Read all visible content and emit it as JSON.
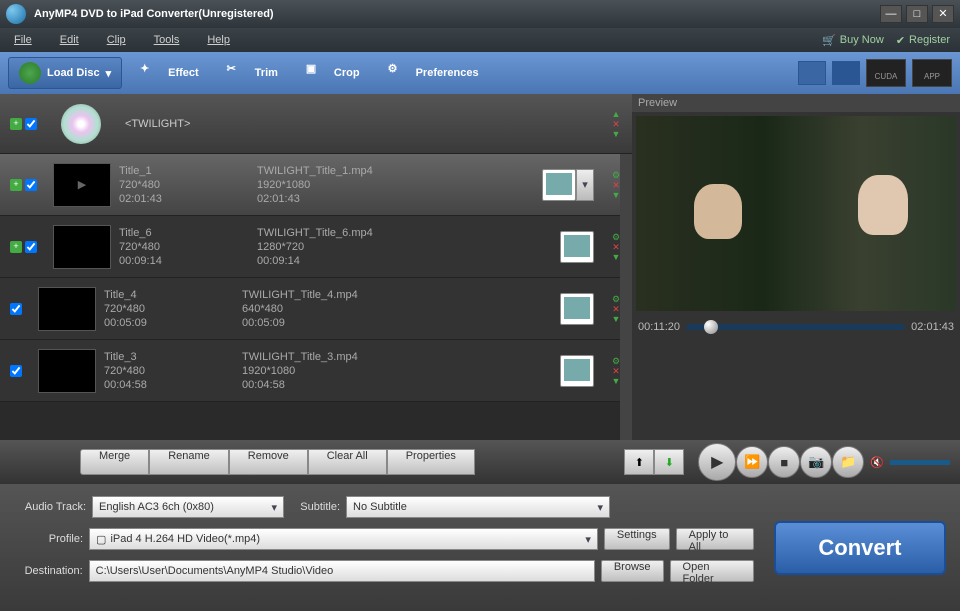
{
  "title": "AnyMP4 DVD to iPad Converter(Unregistered)",
  "menu": {
    "file": "File",
    "edit": "Edit",
    "clip": "Clip",
    "tools": "Tools",
    "help": "Help"
  },
  "header_links": {
    "buy": "Buy Now",
    "register": "Register"
  },
  "toolbar": {
    "load": "Load Disc",
    "effect": "Effect",
    "trim": "Trim",
    "crop": "Crop",
    "prefs": "Preferences"
  },
  "accel": {
    "cuda": "CUDA",
    "app": "APP"
  },
  "disc": {
    "name": "<TWILIGHT>"
  },
  "titles": [
    {
      "name": "Title_1",
      "res": "720*480",
      "dur": "02:01:43",
      "out": "TWILIGHT_Title_1.mp4",
      "outres": "1920*1080",
      "outdur": "02:01:43",
      "sel": true,
      "add": true
    },
    {
      "name": "Title_6",
      "res": "720*480",
      "dur": "00:09:14",
      "out": "TWILIGHT_Title_6.mp4",
      "outres": "1280*720",
      "outdur": "00:09:14",
      "sel": false,
      "add": true
    },
    {
      "name": "Title_4",
      "res": "720*480",
      "dur": "00:05:09",
      "out": "TWILIGHT_Title_4.mp4",
      "outres": "640*480",
      "outdur": "00:05:09",
      "sel": false,
      "add": false
    },
    {
      "name": "Title_3",
      "res": "720*480",
      "dur": "00:04:58",
      "out": "TWILIGHT_Title_3.mp4",
      "outres": "1920*1080",
      "outdur": "00:04:58",
      "sel": false,
      "add": false
    }
  ],
  "actions": {
    "merge": "Merge",
    "rename": "Rename",
    "remove": "Remove",
    "clear": "Clear All",
    "props": "Properties"
  },
  "preview": {
    "label": "Preview",
    "cur": "00:11:20",
    "total": "02:01:43"
  },
  "settings": {
    "audio_lbl": "Audio Track:",
    "audio_val": "English AC3 6ch (0x80)",
    "sub_lbl": "Subtitle:",
    "sub_val": "No Subtitle",
    "profile_lbl": "Profile:",
    "profile_val": "iPad 4 H.264 HD Video(*.mp4)",
    "dest_lbl": "Destination:",
    "dest_val": "C:\\Users\\User\\Documents\\AnyMP4 Studio\\Video",
    "settings_btn": "Settings",
    "apply_btn": "Apply to All",
    "browse_btn": "Browse",
    "open_btn": "Open Folder"
  },
  "convert": "Convert"
}
